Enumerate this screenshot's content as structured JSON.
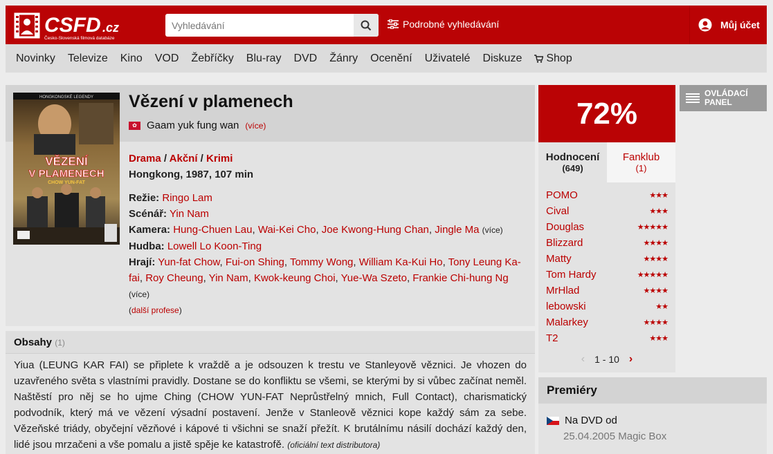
{
  "header": {
    "search_placeholder": "Vyhledávání",
    "advanced_search": "Podrobné vyhledávání",
    "account": "Můj účet",
    "brand_color": "#ba0305"
  },
  "nav": [
    "Novinky",
    "Televize",
    "Kino",
    "VOD",
    "Žebříčky",
    "Blu-ray",
    "DVD",
    "Žánry",
    "Ocenění",
    "Uživatelé",
    "Diskuze",
    "Shop"
  ],
  "film": {
    "title": "Vězení v plamenech",
    "original_title": "Gaam yuk fung wan",
    "more": "(více)",
    "genres": [
      "Drama",
      "Akční",
      "Krimi"
    ],
    "origin": "Hongkong, 1987, 107 min",
    "directing_label": "Režie:",
    "directing": "Ringo Lam",
    "screenplay_label": "Scénář:",
    "screenplay": "Yin Nam",
    "camera_label": "Kamera:",
    "camera": [
      "Hung-Chuen Lau",
      "Wai-Kei Cho",
      "Joe Kwong-Hung Chan",
      "Jingle Ma"
    ],
    "music_label": "Hudba:",
    "music": "Lowell Lo Koon-Ting",
    "cast_label": "Hrají:",
    "cast": [
      "Yun-fat Chow",
      "Fui-on Shing",
      "Tommy Wong",
      "William Ka-Kui Ho",
      "Tony Leung Ka-fai",
      "Roy Cheung",
      "Yin Nam",
      "Kwok-keung Choi",
      "Yue-Wa Szeto",
      "Frankie Chi-hung Ng"
    ],
    "further_professions": "další profese"
  },
  "poster": {
    "banner": "HONGKONGSKÉ LEGENDY",
    "title_line1": "VĚZENÍ",
    "title_line2": "V PLAMENECH",
    "actor": "CHOW YUN-FAT"
  },
  "plot": {
    "heading": "Obsahy",
    "count": "(1)",
    "text": "Yiua (LEUNG KAR FAI) se připlete k vraždě a je odsouzen k trestu ve Stanleyově věznici. Je vhozen do uzavřeného světa s vlastními pravidly. Dostane se do konfliktu se všemi, se kterými by si vůbec začínat neměl. Naštěstí pro něj se ho ujme Ching (CHOW YUN-FAT Neprůstřelný mnich, Full Contact), charismatický podvodník, který má ve vězení výsadní postavení. Jenže v Stanleově věznici kope každý sám za sebe. Vězeňské triády, obyčejní vězňové i kápové ti všichni se snaží přežít. K brutálnímu násilí dochází každý den, lidé jsou mrzačeni a vše pomalu a jistě spěje ke katastrofě.",
    "source": "(oficiální text distributora)"
  },
  "rating": {
    "percent": "72%",
    "tab_ratings": "Hodnocení",
    "tab_ratings_count": "(649)",
    "tab_fanclub": "Fanklub",
    "tab_fanclub_count": "(1)",
    "users": [
      {
        "name": "POMO",
        "stars": 3
      },
      {
        "name": "Cival",
        "stars": 3
      },
      {
        "name": "Douglas",
        "stars": 5
      },
      {
        "name": "Blizzard",
        "stars": 4
      },
      {
        "name": "Matty",
        "stars": 4
      },
      {
        "name": "Tom Hardy",
        "stars": 5
      },
      {
        "name": "MrHlad",
        "stars": 4
      },
      {
        "name": "lebowski",
        "stars": 2
      },
      {
        "name": "Malarkey",
        "stars": 4
      },
      {
        "name": "T2",
        "stars": 3
      }
    ],
    "pager": "1 - 10"
  },
  "control_panel": {
    "line1": "OVLÁDACÍ",
    "line2": "PANEL"
  },
  "premieres": {
    "heading": "Premiéry",
    "item_label": "Na DVD od",
    "item_date": "25.04.2005 Magic Box"
  }
}
